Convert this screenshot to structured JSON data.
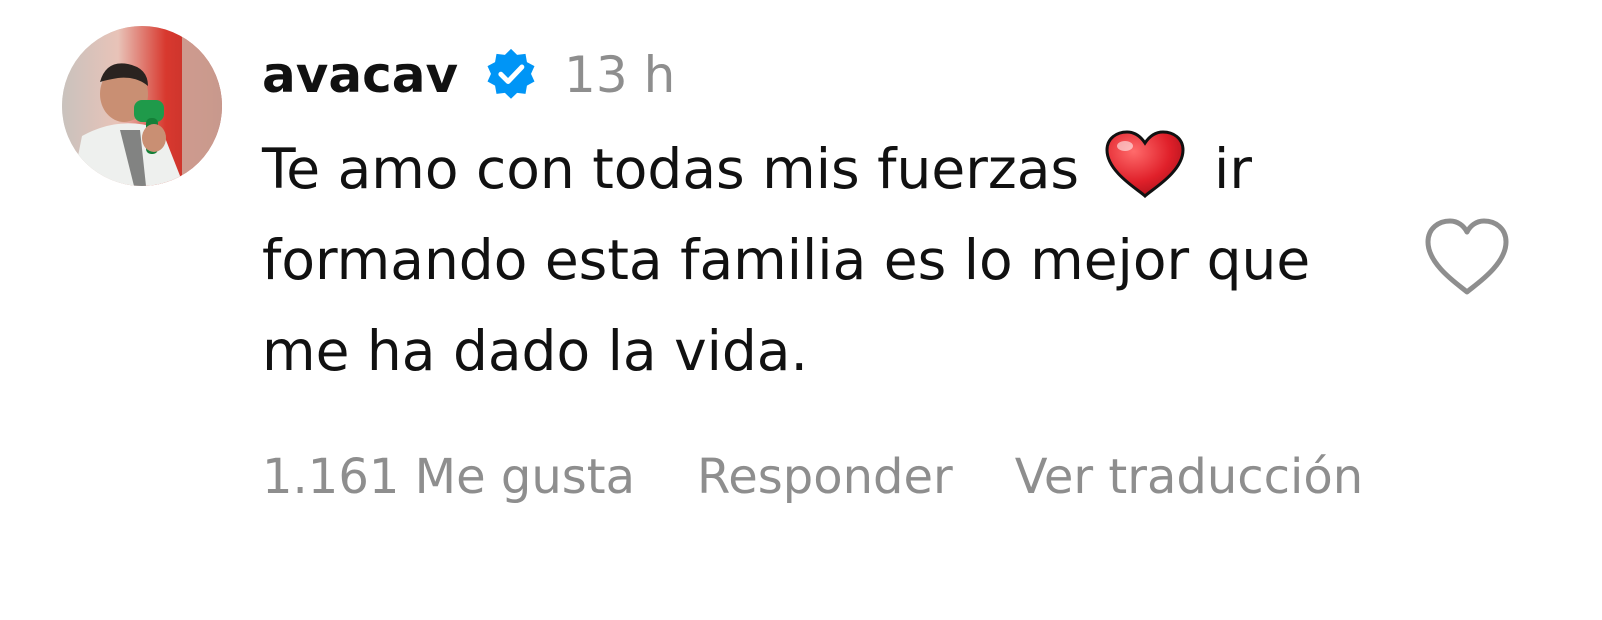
{
  "comment": {
    "username": "avacav",
    "verified": true,
    "timestamp": "13 h",
    "text_part1": "Te amo con todas mis fuerzas",
    "emoji": "red-heart",
    "text_part2": "ir formando esta familia es lo mejor que me ha dado la vida.",
    "likes_label": "1.161 Me gusta",
    "reply_label": "Responder",
    "translate_label": "Ver traducción",
    "like_icon": "heart-outline-icon"
  },
  "colors": {
    "verified_blue": "#0095f6",
    "muted_gray": "#8e8e8e",
    "emoji_red": "#e0202a"
  }
}
